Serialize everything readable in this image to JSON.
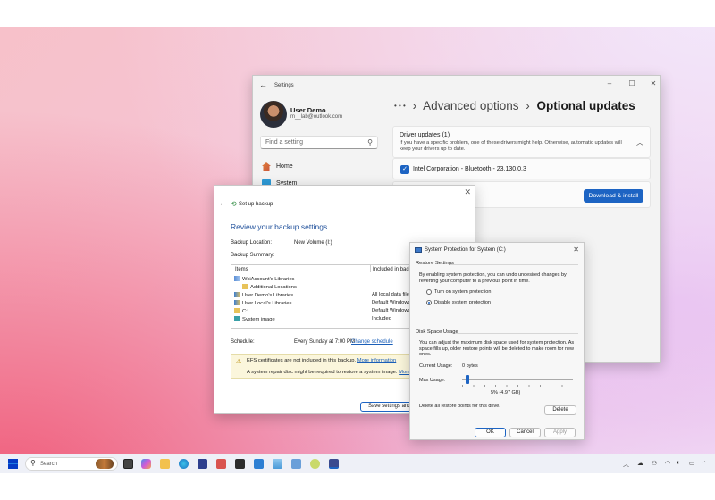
{
  "settings": {
    "title": "Settings",
    "user": {
      "name": "User Demo",
      "email": "m__lab@outlook.com"
    },
    "search_placeholder": "Find a setting",
    "nav": [
      {
        "label": "Home"
      },
      {
        "label": "System"
      }
    ],
    "breadcrumb": {
      "more": "• • •",
      "parent": "Advanced options",
      "sep": "›",
      "current": "Optional updates"
    },
    "driver_section": {
      "title": "Driver updates (1)",
      "description": "If you have a specific problem, one of these drivers might help. Otherwise, automatic updates will keep your drivers up to date."
    },
    "driver_item": "Intel Corporation - Bluetooth - 23.130.0.3",
    "download_button": "Download & install"
  },
  "backup": {
    "title": "Set up backup",
    "heading": "Review your backup settings",
    "location_label": "Backup Location:",
    "location_value": "New Volume (I:)",
    "summary_label": "Backup Summary:",
    "columns": {
      "items": "Items",
      "included": "Included in backup"
    },
    "items": [
      {
        "name": "WsiAccount's Libraries",
        "included": ""
      },
      {
        "name": "Additional Locations",
        "included": ""
      },
      {
        "name": "User Demo's Libraries",
        "included": "All local data files"
      },
      {
        "name": "User Local's Libraries",
        "included": "Default Windows"
      },
      {
        "name": "C:\\",
        "included": "Default Windows"
      },
      {
        "name": "System image",
        "included": "All local data files"
      },
      {
        "name": "",
        "included": "Included"
      }
    ],
    "schedule_label": "Schedule:",
    "schedule_value": "Every Sunday at 7:00 PM",
    "change_schedule": "Change schedule",
    "note_efs": "EFS certificates are not included in this backup.",
    "note_efs_link": "More information",
    "note_repair": "A system repair disc might be required to restore a system image.",
    "note_repair_link": "More in",
    "save_button": "Save settings and run"
  },
  "system_protection": {
    "title": "System Protection for System (C:)",
    "restore_header": "Restore Settings",
    "restore_desc": "By enabling system protection, you can undo undesired changes by reverting your computer to a previous point in time.",
    "option_on": "Turn on system protection",
    "option_off": "Disable system protection",
    "selected_option": "off",
    "disk_header": "Disk Space Usage",
    "disk_desc": "You can adjust the maximum disk space used for system protection. As space fills up, older restore points will be deleted to make room for new ones.",
    "current_usage_label": "Current Usage:",
    "current_usage_value": "0 bytes",
    "max_usage_label": "Max Usage:",
    "max_usage_percent": 5,
    "max_usage_text": "5% (4.97 GB)",
    "delete_desc": "Delete all restore points for this drive.",
    "delete_button": "Delete",
    "ok_button": "OK",
    "cancel_button": "Cancel",
    "apply_button": "Apply"
  },
  "taskbar": {
    "search_placeholder": "Search"
  },
  "colors": {
    "accent": "#1d64c3",
    "link": "#1b5fb8",
    "heading_blue": "#1e4f9a"
  }
}
